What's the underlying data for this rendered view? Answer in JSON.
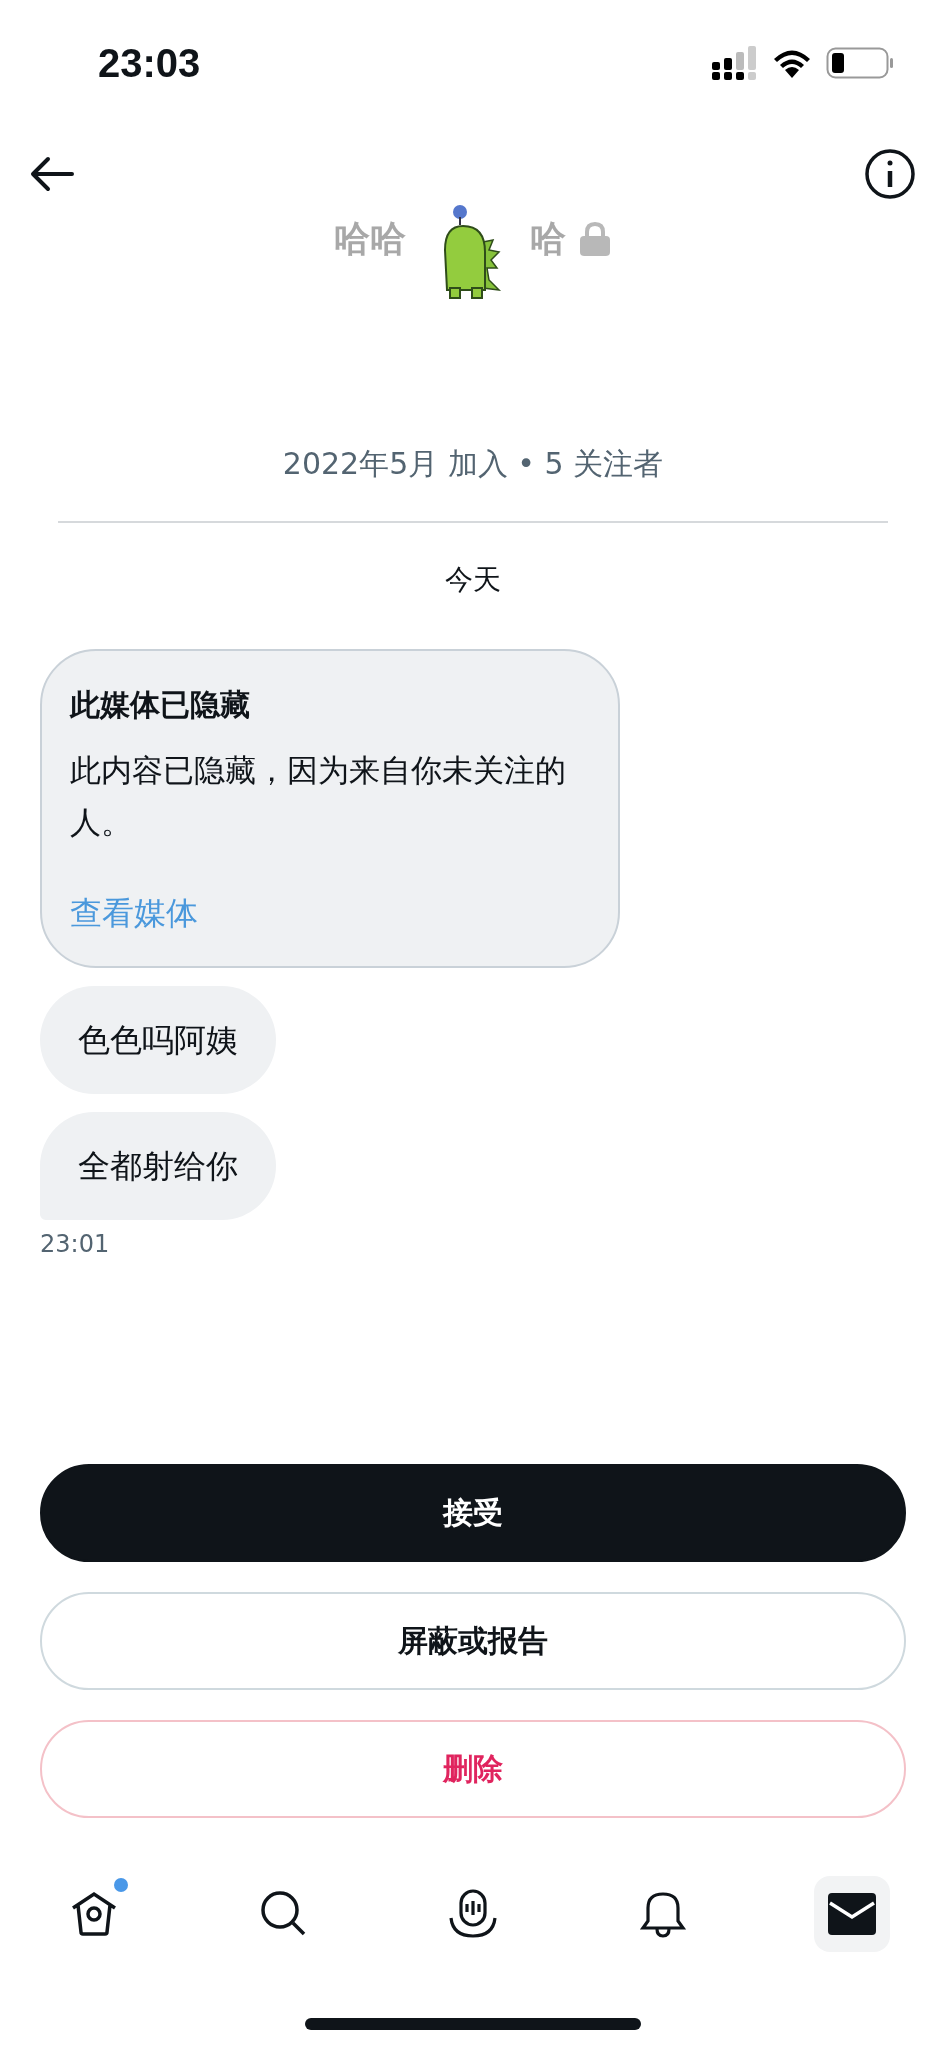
{
  "status_bar": {
    "time": "23:03"
  },
  "profile": {
    "name_parts": [
      "哈哈",
      "哈"
    ],
    "locked": true,
    "joined": "2022年5月 加入 • 5 关注者"
  },
  "day_label": "今天",
  "messages": [
    {
      "kind": "hidden_media",
      "title": "此媒体已隐藏",
      "body": "此内容已隐藏，因为来自你未关注的人。",
      "link": "查看媒体"
    },
    {
      "kind": "text",
      "text": "色色吗阿姨"
    },
    {
      "kind": "text",
      "text": "全都射给你"
    }
  ],
  "message_time": "23:01",
  "actions": [
    {
      "kind": "primary",
      "label": "接受"
    },
    {
      "kind": "outline",
      "label": "屏蔽或报告"
    },
    {
      "kind": "danger",
      "label": "删除"
    }
  ],
  "tab_bar": [
    {
      "kind": "home",
      "selected": false,
      "badge": true
    },
    {
      "kind": "search",
      "selected": false,
      "badge": false
    },
    {
      "kind": "spaces",
      "selected": false,
      "badge": false
    },
    {
      "kind": "notifications",
      "selected": false,
      "badge": false
    },
    {
      "kind": "messages",
      "selected": true,
      "badge": false
    }
  ]
}
